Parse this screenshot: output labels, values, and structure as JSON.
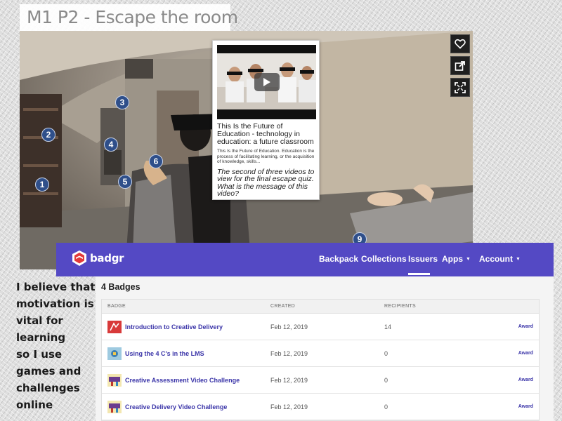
{
  "page": {
    "title": "M1 P2 - Escape the room"
  },
  "scene": {
    "hotspots": [
      "1",
      "2",
      "3",
      "4",
      "5",
      "6",
      "9"
    ],
    "buttons": {
      "favorite_icon": "heart-icon",
      "share_icon": "share-icon",
      "fullscreen_icon": "fullscreen-icon"
    }
  },
  "popup": {
    "video_title": "This Is the Future of Education - technology in education: a future classroom",
    "video_description": "This Is the Future of Education. Education is the process of facilitating learning, or the acquisition of knowledge, skills...",
    "question": "The second of three videos to view for the final escape quiz. What is the message of this video?"
  },
  "badgr": {
    "logo_text": "badgr",
    "nav": {
      "backpack": "Backpack",
      "collections": "Collections",
      "issuers": "Issuers",
      "apps": "Apps",
      "account": "Account"
    },
    "badge_count": "4 Badges",
    "columns": {
      "badge": "BADGE",
      "created": "CREATED",
      "recipients": "RECIPIENTS"
    },
    "rows": [
      {
        "name": "Introduction to Creative Delivery",
        "created": "Feb 12, 2019",
        "recipients": "14",
        "action": "Award"
      },
      {
        "name": "Using the 4 C's in the LMS",
        "created": "Feb 12, 2019",
        "recipients": "0",
        "action": "Award"
      },
      {
        "name": "Creative Assessment Video Challenge",
        "created": "Feb 12, 2019",
        "recipients": "0",
        "action": "Award"
      },
      {
        "name": "Creative Delivery Video Challenge",
        "created": "Feb 12, 2019",
        "recipients": "0",
        "action": "Award"
      }
    ],
    "colors": {
      "header": "#5449c4",
      "link": "#3a34a8"
    }
  },
  "caption": {
    "lines": [
      "I believe that",
      "motivation is",
      "vital for",
      "learning",
      "so I use",
      "games and",
      "challenges",
      "online"
    ]
  }
}
